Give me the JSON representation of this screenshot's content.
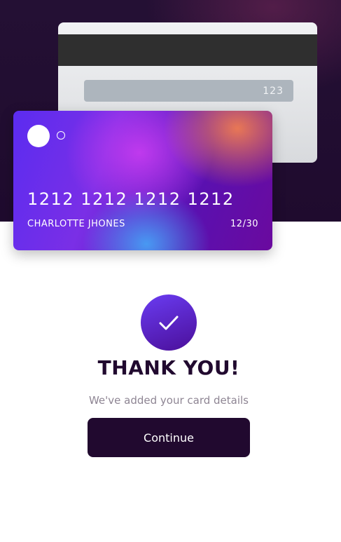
{
  "card_back": {
    "cvc": "123"
  },
  "card_front": {
    "number": "1212 1212 1212 1212",
    "holder": "CHARLOTTE JHONES",
    "expiry": "12/30"
  },
  "success": {
    "icon": "check-icon",
    "title": "THANK YOU!",
    "subtitle": "We've added your card details"
  },
  "actions": {
    "continue_label": "Continue"
  },
  "colors": {
    "primary": "#21092f",
    "text_muted": "#8e8593",
    "card_gradient_start": "#5b2cf0",
    "card_gradient_end": "#6a0a9e"
  }
}
